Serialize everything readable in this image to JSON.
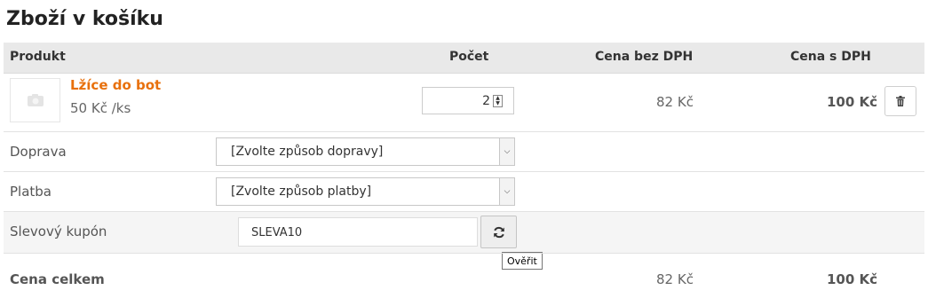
{
  "page": {
    "title": "Zboží v košíku"
  },
  "table": {
    "headers": {
      "product": "Produkt",
      "count": "Počet",
      "price_no_vat": "Cena bez DPH",
      "price_vat": "Cena s DPH"
    }
  },
  "item": {
    "name": "Lžíce do bot",
    "unit_price": "50 Kč /ks",
    "quantity": "2",
    "price_no_vat": "82 Kč",
    "price_vat": "100 Kč",
    "image_icon": "photo-placeholder-icon",
    "delete_icon": "trash-icon"
  },
  "shipping": {
    "label": "Doprava",
    "selected": "[Zvolte způsob dopravy]"
  },
  "payment": {
    "label": "Platba",
    "selected": "[Zvolte způsob platby]"
  },
  "coupon": {
    "label": "Slevový kupón",
    "value": "SLEVA10",
    "button_icon": "refresh-icon",
    "tooltip": "Ověřit"
  },
  "total": {
    "label": "Cena celkem",
    "price_no_vat": "82 Kč",
    "price_vat": "100 Kč"
  },
  "colors": {
    "accent": "#e8700c",
    "header_bg": "#e9e9e9"
  }
}
